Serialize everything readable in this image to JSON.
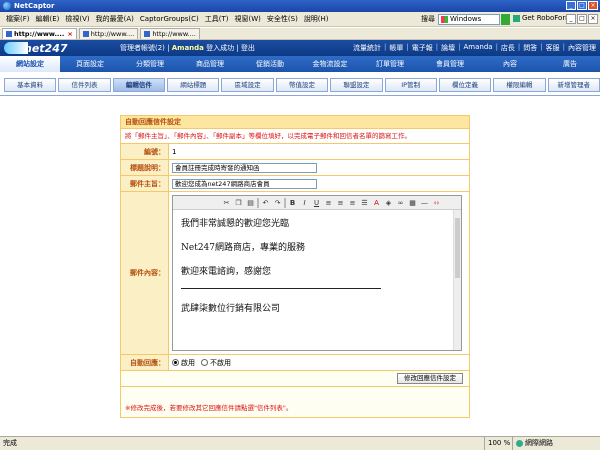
{
  "browser": {
    "title": "NetCaptor",
    "menu": [
      "檔案(F)",
      "編輯(E)",
      "檢視(V)",
      "我的最愛(A)",
      "CaptorGroups(C)",
      "工具(T)",
      "視窗(W)",
      "安全性(S)",
      "說明(H)"
    ],
    "search_label": "搜尋",
    "search_value": "Windows",
    "robo_label": "Get RoboForm",
    "tabs": [
      {
        "label": "http://www...."
      },
      {
        "label": "http://www...."
      },
      {
        "label": "http://www...."
      }
    ]
  },
  "header": {
    "logo": "net247",
    "greeting_prefix": "管理者帳號(2)",
    "greeting_user": "Amanda",
    "greeting_suffix": "登入成功 | 登出",
    "links": [
      "流量統計",
      "帳單",
      "電子報",
      "論壇",
      "Amanda",
      "店長",
      "問答",
      "客服",
      "內容管理"
    ]
  },
  "main_nav": [
    "網站設定",
    "頁面設定",
    "分類管理",
    "商品管理",
    "促銷活動",
    "金物流設定",
    "訂單管理",
    "會員管理",
    "內容",
    "廣告"
  ],
  "sub_nav": [
    "基本資料",
    "信件列表",
    "編輯信件",
    "網站標題",
    "區域設定",
    "幣值設定",
    "聯盟設定",
    "IP管制",
    "欄位定義",
    "權限編輯",
    "新增管理者"
  ],
  "panel": {
    "title": "自動回應信件設定",
    "note": "將「郵件主旨」、「郵件內容」、「郵件副本」等欄位填好，以完成電子郵件和回信者名單的篩寫工作。",
    "labels": {
      "id": "編號：",
      "title": "標題說明：",
      "subject": "郵件主旨：",
      "content": "郵件內容：",
      "reply": "自動回應："
    },
    "values": {
      "id": "1",
      "title": "會員註冊完成時寄發的通知函",
      "subject": "歡迎您成為net247網路商店會員"
    },
    "editor": {
      "lines": [
        "我們非常誠懇的歡迎您光臨",
        "Net247網路商店，專業的服務",
        "歡迎來電諮詢，感謝您",
        "武肆柒數位行銷有限公司"
      ]
    },
    "reply_options": [
      {
        "label": "啟用",
        "selected": true
      },
      {
        "label": "不啟用",
        "selected": false
      }
    ],
    "button": "修改回應信件設定",
    "footnote": "※修改完成後，若要修改其它回應信件請點選\"信件列表\"。"
  },
  "status": {
    "text": "完成",
    "zoom": "100 %",
    "zone": "網際網路"
  }
}
